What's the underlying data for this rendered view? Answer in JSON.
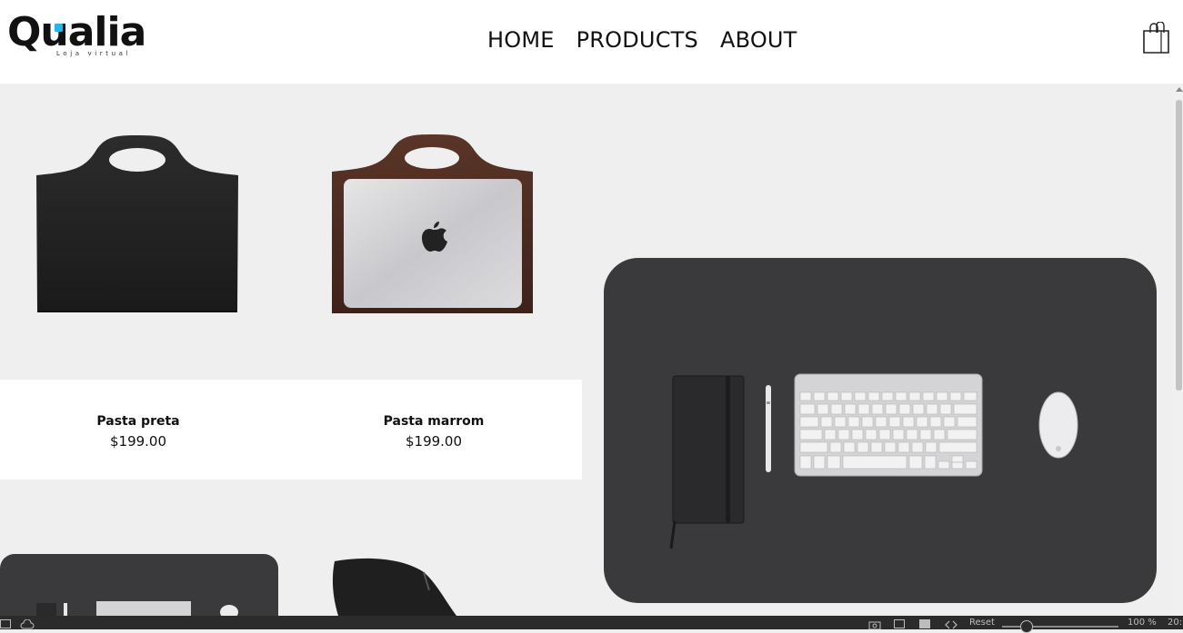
{
  "brand": {
    "name": "Qualia",
    "tagline": "Loja virtual",
    "accent": "#2bb4e6"
  },
  "nav": {
    "home": "HOME",
    "products": "PRODUCTS",
    "about": "ABOUT"
  },
  "products": [
    {
      "name": "Pasta preta",
      "price": "$199.00"
    },
    {
      "name": "Pasta marrom",
      "price": "$199.00"
    }
  ],
  "statusbar": {
    "reset": "Reset",
    "zoom": "100 %",
    "time": "20:"
  },
  "icons": {
    "cart": "shopping-bag-icon"
  }
}
